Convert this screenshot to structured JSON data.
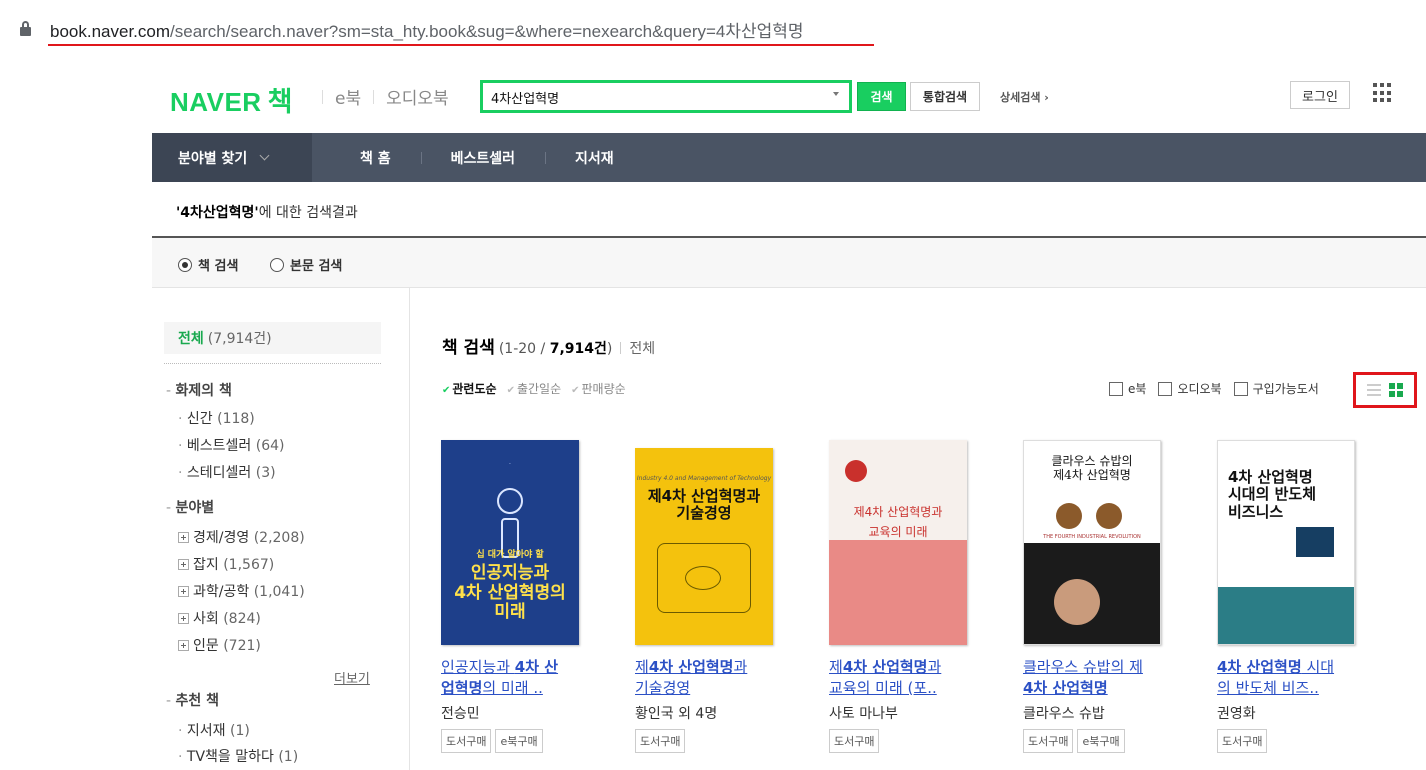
{
  "browser": {
    "url_host": "book.naver.com",
    "url_path": "/search/search.naver?sm=sta_hty.book&sug=&where=nexearch&query=4차산업혁명"
  },
  "header": {
    "logo_naver": "NAVER",
    "logo_book": "책",
    "link_ebook": "e북",
    "link_audiobook": "오디오북",
    "search_value": "4차산업혁명",
    "search_button": "검색",
    "total_search_button": "통합검색",
    "detail_search": "상세검색 ›",
    "login": "로그인"
  },
  "nav": {
    "category": "분야별 찾기",
    "items": [
      "책 홈",
      "베스트셀러",
      "지서재"
    ]
  },
  "result": {
    "query": "'4차산업혁명'",
    "suffix": "에 대한 검색결과"
  },
  "scope": {
    "book_search": "책 검색",
    "text_search": "본문 검색"
  },
  "sidebar": {
    "all_label": "전체",
    "all_count": "(7,914건)",
    "hot_heading": "화제의 책",
    "hot_items": [
      {
        "label": "신간",
        "count": "(118)"
      },
      {
        "label": "베스트셀러",
        "count": "(64)"
      },
      {
        "label": "스테디셀러",
        "count": "(3)"
      }
    ],
    "field_heading": "분야별",
    "field_items": [
      {
        "label": "경제/경영",
        "count": "(2,208)"
      },
      {
        "label": "잡지",
        "count": "(1,567)"
      },
      {
        "label": "과학/공학",
        "count": "(1,041)"
      },
      {
        "label": "사회",
        "count": "(824)"
      },
      {
        "label": "인문",
        "count": "(721)"
      }
    ],
    "more": "더보기",
    "rec_heading": "추천 책",
    "rec_items": [
      {
        "label": "지서재",
        "count": "(1)"
      },
      {
        "label": "TV책을 말하다",
        "count": "(1)"
      }
    ]
  },
  "main": {
    "title": "책 검색",
    "range_prefix": "(1-20 / ",
    "range_total": "7,914건",
    "range_suffix": ")",
    "all": "전체",
    "sort": [
      "관련도순",
      "출간일순",
      "판매량순"
    ],
    "filter_ebook": "e북",
    "filter_audio": "오디오북",
    "filter_buyable": "구입가능도서"
  },
  "books": [
    {
      "title_l1a": "인공지능과 ",
      "title_l1b": "4차 산",
      "title_l2a": "업혁명",
      "title_l2b": "의 미래 ..",
      "author": "전승민",
      "tags": [
        "도서구매",
        "e북구매"
      ],
      "cover_text": "인공지능과\n4차 산업혁명의\n미래",
      "cover_top": "십 대가 알아야 할",
      "cover_color": "#1e3f8a"
    },
    {
      "title_l1a": "제",
      "title_l1b": "4차 산업혁명",
      "title_l1c": "과",
      "title_l2a": "기술경영",
      "author": "황인국 외 4명",
      "tags": [
        "도서구매"
      ],
      "cover_text": "제4차 산업혁명과\n기술경영",
      "cover_top": "Industry 4.0 and Management of Technology",
      "cover_color": "#f4c20d"
    },
    {
      "title_l1a": "제",
      "title_l1b": "4차 산업혁명",
      "title_l1c": "과",
      "title_l2a": "교육의 미래 (포..",
      "author": "사토 마나부",
      "tags": [
        "도서구매"
      ],
      "cover_text": "제4차 산업혁명과\n교육의 미래",
      "cover_top": "",
      "cover_color": "#e98a86"
    },
    {
      "title_l1a": "클라우스 슈밥의 제",
      "title_l2a": "4차 산업혁명",
      "author": "클라우스 슈밥",
      "tags": [
        "도서구매",
        "e북구매"
      ],
      "cover_text": "클라우스 슈밥의\n제4차 산업혁명",
      "cover_top": "THE FOURTH INDUSTRIAL REVOLUTION",
      "cover_color": "#ffffff"
    },
    {
      "title_l1a": "4차 산업혁명",
      "title_l1b": " 시대",
      "title_l2a": "의 반도체 비즈..",
      "author": "권영화",
      "tags": [
        "도서구매"
      ],
      "cover_text": "4차 산업혁명\n시대의 반도체\n비즈니스",
      "cover_top": "",
      "cover_color": "#ffffff"
    }
  ]
}
